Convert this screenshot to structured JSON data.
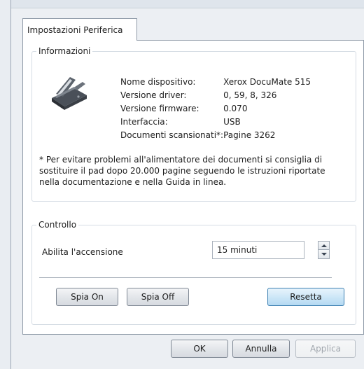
{
  "dialog": {
    "tab_label": "Impostazioni Periferica"
  },
  "info": {
    "legend": "Informazioni",
    "device_icon": "scanner-icon",
    "properties": [
      {
        "label": "Nome dispositivo:",
        "value": "Xerox DocuMate 515"
      },
      {
        "label": "Versione driver:",
        "value": "0, 59, 8, 326"
      },
      {
        "label": "Versione firmware:",
        "value": "0.070"
      },
      {
        "label": "Interfaccia:",
        "value": "USB"
      },
      {
        "label": "Documenti scansionati*:",
        "value": "Pagine 3262"
      }
    ],
    "note": "* Per evitare problemi all'alimentatore dei documenti si consiglia di sostituire il pad dopo 20.000 pagine seguendo le istruzioni riportate nella documentazione e nella Guida in linea."
  },
  "control": {
    "legend": "Controllo",
    "power_label": "Abilita l'accensione",
    "power_value": "15 minuti",
    "spia_on": "Spia On",
    "spia_off": "Spia Off",
    "reset": "Resetta"
  },
  "footer": {
    "ok": "OK",
    "cancel": "Annulla",
    "apply": "Applica"
  },
  "colors": {
    "window_bg": "#eceff3",
    "panel_bg": "#ffffff",
    "primary_button": "#cbe6f7",
    "border": "#8e99a7"
  }
}
